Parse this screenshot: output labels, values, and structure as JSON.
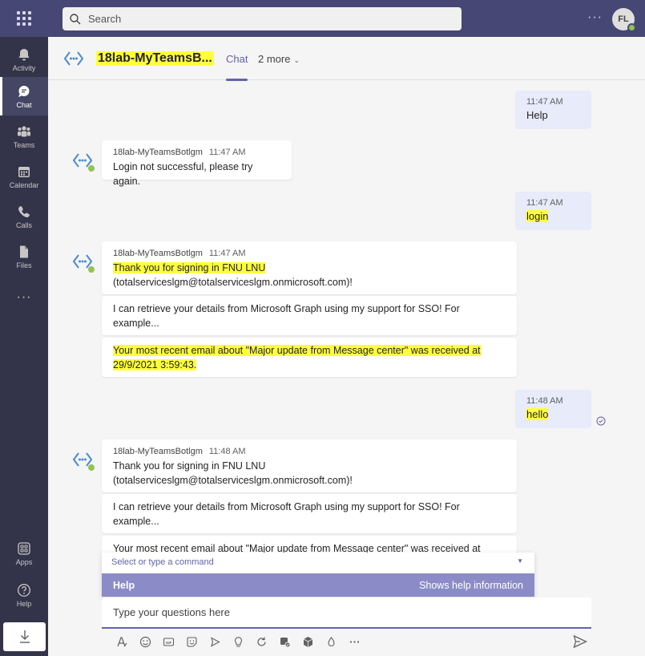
{
  "topbar": {
    "search_placeholder": "Search",
    "more_label": "···",
    "avatar_initials": "FL"
  },
  "rail": {
    "items": [
      {
        "label": "Activity",
        "icon": "bell-icon"
      },
      {
        "label": "Chat",
        "icon": "chat-icon"
      },
      {
        "label": "Teams",
        "icon": "teams-icon"
      },
      {
        "label": "Calendar",
        "icon": "calendar-icon"
      },
      {
        "label": "Calls",
        "icon": "phone-icon"
      },
      {
        "label": "Files",
        "icon": "file-icon"
      }
    ],
    "more_label": "···",
    "apps_label": "Apps",
    "help_label": "Help"
  },
  "header": {
    "title": "18lab-MyTeamsB...",
    "tab_chat": "Chat",
    "tab_more": "2 more"
  },
  "messages": {
    "m1": {
      "time": "11:47 AM",
      "text": "Help"
    },
    "b1": {
      "sender": "18lab-MyTeamsBotlgm",
      "time": "11:47 AM",
      "text": "Login not successful, please try again."
    },
    "m2": {
      "time": "11:47 AM",
      "text": "login"
    },
    "b2": {
      "sender": "18lab-MyTeamsBotlgm",
      "time": "11:47 AM",
      "line1": "Thank you for signing in FNU LNU",
      "line2": "(totalserviceslgm@totalserviceslgm.onmicrosoft.com)!",
      "card2": "I can retrieve your details from Microsoft Graph using my support for SSO! For example...",
      "card3": "Your most recent email about \"Major update from Message center\" was received at 29/9/2021 3:59:43."
    },
    "m3": {
      "time": "11:48 AM",
      "text": "hello"
    },
    "b3": {
      "sender": "18lab-MyTeamsBotlgm",
      "time": "11:48 AM",
      "line1": "Thank you for signing in FNU LNU",
      "line2": "(totalserviceslgm@totalserviceslgm.onmicrosoft.com)!",
      "card2": "I can retrieve your details from Microsoft Graph using my support for SSO! For example...",
      "card3": "Your most recent email about \"Major update from Message center\" was received at"
    }
  },
  "command": {
    "placeholder": "Select or type a command",
    "suggestion_name": "Help",
    "suggestion_desc": "Shows help information"
  },
  "compose": {
    "value": "",
    "placeholder": "Type your questions here"
  },
  "colors": {
    "topbar": "#464775",
    "rail": "#33344a",
    "accent": "#6264a7",
    "highlight": "#ffff3c",
    "my_bubble": "#e8ebfa"
  }
}
